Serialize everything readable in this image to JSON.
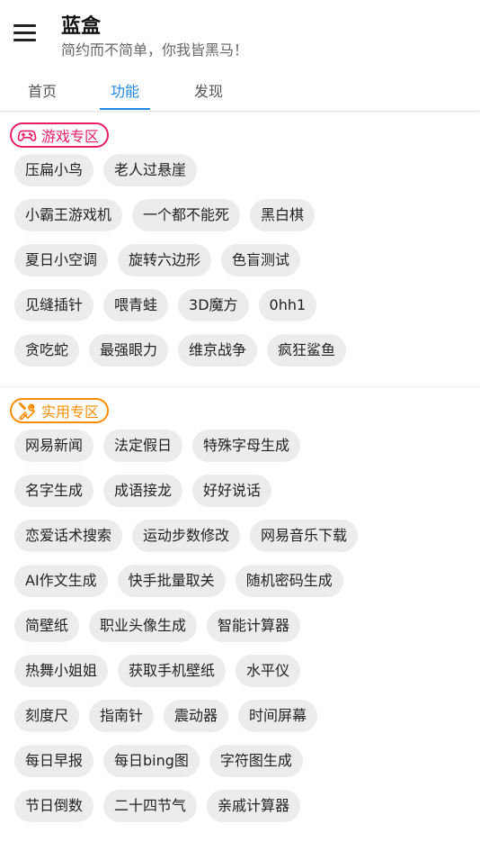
{
  "header": {
    "title": "蓝盒",
    "subtitle": "简约而不简单，你我皆黑马！"
  },
  "tabs": [
    {
      "label": "首页",
      "active": false
    },
    {
      "label": "功能",
      "active": true
    },
    {
      "label": "发现",
      "active": false
    }
  ],
  "colors": {
    "accent": "#1e88e5",
    "games_badge": "#e91e63",
    "tools_badge": "#fb8c00",
    "chip_bg": "#ececec"
  },
  "sections": [
    {
      "title": "游戏专区",
      "icon": "gamepad-icon",
      "rows": [
        [
          "压扁小鸟",
          "老人过悬崖"
        ],
        [
          "小霸王游戏机",
          "一个都不能死",
          "黑白棋"
        ],
        [
          "夏日小空调",
          "旋转六边形",
          "色盲测试"
        ],
        [
          "见缝插针",
          "喂青蛙",
          "3D魔方",
          "0hh1"
        ],
        [
          "贪吃蛇",
          "最强眼力",
          "维京战争",
          "疯狂鲨鱼"
        ]
      ]
    },
    {
      "title": "实用专区",
      "icon": "tools-icon",
      "rows": [
        [
          "网易新闻",
          "法定假日",
          "特殊字母生成"
        ],
        [
          "名字生成",
          "成语接龙",
          "好好说话"
        ],
        [
          "恋爱话术搜索",
          "运动步数修改",
          "网易音乐下载"
        ],
        [
          "AI作文生成",
          "快手批量取关",
          "随机密码生成"
        ],
        [
          "简壁纸",
          "职业头像生成",
          "智能计算器"
        ],
        [
          "热舞小姐姐",
          "获取手机壁纸",
          "水平仪"
        ],
        [
          "刻度尺",
          "指南针",
          "震动器",
          "时间屏幕"
        ],
        [
          "每日早报",
          "每日bing图",
          "字符图生成"
        ],
        [
          "节日倒数",
          "二十四节气",
          "亲戚计算器"
        ]
      ]
    }
  ]
}
